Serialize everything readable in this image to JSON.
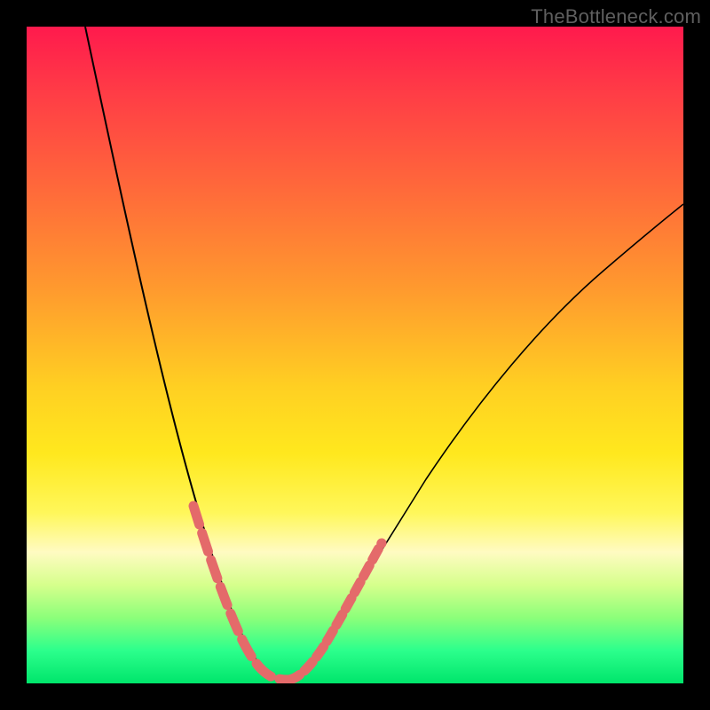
{
  "watermark": "TheBottleneck.com",
  "colors": {
    "frame": "#000000",
    "watermark_text": "#5f5f5f",
    "curve_stroke": "#000000",
    "bead_stroke": "#e46a6a",
    "gradient_stops": [
      {
        "pct": 0,
        "hex": "#ff1a4d"
      },
      {
        "pct": 10,
        "hex": "#ff3c46"
      },
      {
        "pct": 25,
        "hex": "#ff6a3a"
      },
      {
        "pct": 40,
        "hex": "#ff9a2e"
      },
      {
        "pct": 55,
        "hex": "#ffd022"
      },
      {
        "pct": 65,
        "hex": "#ffe81e"
      },
      {
        "pct": 74,
        "hex": "#fff75a"
      },
      {
        "pct": 80,
        "hex": "#fffbc2"
      },
      {
        "pct": 85,
        "hex": "#d6ff8c"
      },
      {
        "pct": 90,
        "hex": "#8cff7a"
      },
      {
        "pct": 95,
        "hex": "#2cff8c"
      },
      {
        "pct": 100,
        "hex": "#00e56b"
      }
    ]
  },
  "chart_data": {
    "type": "line",
    "title": "",
    "xlabel": "",
    "ylabel": "",
    "xlim": [
      0,
      100
    ],
    "ylim": [
      0,
      100
    ],
    "grid": false,
    "legend": false,
    "annotations": [
      "TheBottleneck.com"
    ],
    "series": [
      {
        "name": "bottleneck-curve-left",
        "x": [
          9,
          12,
          15,
          18,
          21,
          24,
          27,
          30,
          33,
          35
        ],
        "y": [
          100,
          85,
          70,
          55,
          41,
          29,
          19,
          10,
          4,
          1
        ]
      },
      {
        "name": "bottleneck-curve-right",
        "x": [
          35,
          38,
          42,
          47,
          53,
          60,
          68,
          77,
          87,
          98
        ],
        "y": [
          1,
          4,
          11,
          21,
          32,
          43,
          53,
          62,
          70,
          76
        ]
      }
    ],
    "highlight_segments": {
      "name": "bead-overlay",
      "description": "pink dashed bead overlay on lower portions of both branches",
      "left_branch_y_range": [
        1,
        28
      ],
      "right_branch_y_range": [
        1,
        28
      ]
    },
    "background": {
      "description": "vertical heat gradient red→orange→yellow→green symbolizing bottleneck severity",
      "top_color": "#ff1a4d",
      "bottom_color": "#00e56b"
    }
  }
}
